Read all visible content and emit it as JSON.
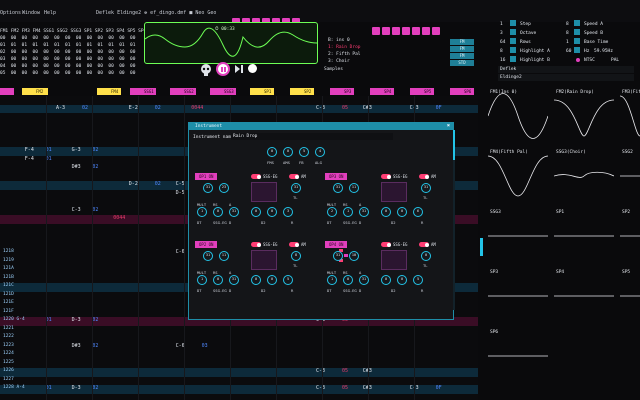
{
  "menu": {
    "items": [
      "Options",
      "Window",
      "Help"
    ],
    "title": "Deflek Eldinge2 ❁ ef_dingo.dmf ■ Neo Geo"
  },
  "channel_table": {
    "header": "FM1 FM2 FM3 FM4 SSG1 SSG2 SSG3 SP1 SP2 SP3 SP4 SP5 SP6",
    "rows": [
      "00  00  00  00  00  00  00  00  00  00  00  00  00",
      "01  01  01  01  01  01  01  01  01  01  01  01  01",
      "02  00  00  00  00  00  00  00  00  00  00  00  00",
      "03  00  00  00  00  00  00  00  00  00  00  00  00",
      "04  00  00  00  00  00  00  00  00  00  00  00  00",
      "05  00  00  00  00  00  00  00  00  00  00  00  00"
    ]
  },
  "scope": {
    "time": "⏱ 00:33"
  },
  "instruments": {
    "label": "B: ins 0",
    "items": [
      "1: Rain Drop",
      "2: Fifth Pal",
      "3: Choir"
    ],
    "selected_index": 0,
    "samples_label": "Samples",
    "fm_buttons": [
      "FM",
      "FM",
      "FM",
      "STD"
    ]
  },
  "settings": {
    "rows": [
      {
        "num1": "1",
        "label1": "Step",
        "num2": "8",
        "label2": "Speed A"
      },
      {
        "num1": "3",
        "label1": "Octave",
        "num2": "8",
        "label2": "Speed B"
      },
      {
        "num1": "64",
        "label1": "Rows",
        "num2": "1",
        "label2": "Base Time"
      },
      {
        "num1": "8",
        "label1": "Highlight A",
        "num2": "60",
        "label2": "Hz"
      },
      {
        "num1": "16",
        "label1": "Highlight B",
        "num2": "",
        "label2": "NTSC"
      }
    ],
    "hz_value": "59.95Hz",
    "region": "PAL",
    "song_author": "Deflek",
    "song_name": "Eldinge2"
  },
  "channel_headers": [
    {
      "label": "FM1",
      "color": "#e23fbd"
    },
    {
      "label": "FM2",
      "color": "#ffe04a"
    },
    {
      "label": "FM3",
      "color": "#e23fbd"
    },
    {
      "label": "FM4",
      "color": "#ffe04a"
    },
    {
      "label": "SSG1",
      "color": "#e23fbd"
    },
    {
      "label": "SSG2",
      "color": "#e23fbd"
    },
    {
      "label": "SSG3",
      "color": "#e23fbd"
    },
    {
      "label": "SP1",
      "color": "#ffe04a"
    },
    {
      "label": "SP2",
      "color": "#ffe04a"
    },
    {
      "label": "SP3",
      "color": "#e23fbd"
    },
    {
      "label": "SP4",
      "color": "#e23fbd"
    },
    {
      "label": "SP5",
      "color": "#e23fbd"
    },
    {
      "label": "SP6",
      "color": "#e23fbd"
    }
  ],
  "pattern_rows": [
    {
      "num": "",
      "hl": "none",
      "cells": []
    },
    {
      "num": "",
      "hl": "hl",
      "cells": [
        {
          "c": 1,
          "t": "A-3",
          "k": "note"
        },
        {
          "c": 1.5,
          "t": "02",
          "k": "inst"
        },
        {
          "c": 2.4,
          "t": "E-2",
          "k": "note"
        },
        {
          "c": 2.9,
          "t": "02",
          "k": "inst"
        },
        {
          "c": 3.6,
          "t": "0044",
          "k": "fx"
        },
        {
          "c": 6,
          "t": "C-3",
          "k": "note"
        },
        {
          "c": 6.5,
          "t": "05",
          "k": "fx"
        },
        {
          "c": 6.9,
          "t": "C#3",
          "k": "note"
        },
        {
          "c": 7.8,
          "t": "C-3",
          "k": "note"
        },
        {
          "c": 8.3,
          "t": "0F",
          "k": "inst"
        }
      ]
    },
    {
      "num": "",
      "hl": "none",
      "cells": []
    },
    {
      "num": "",
      "hl": "none",
      "cells": []
    },
    {
      "num": "",
      "hl": "none",
      "cells": []
    },
    {
      "num": "",
      "hl": "none",
      "cells": []
    },
    {
      "num": "",
      "hl": "hl",
      "cells": [
        {
          "c": 0.4,
          "t": "F-4",
          "k": "note"
        },
        {
          "c": 0.8,
          "t": "01",
          "k": "inst"
        },
        {
          "c": 1.3,
          "t": "G-3",
          "k": "note"
        },
        {
          "c": 1.7,
          "t": "02",
          "k": "inst"
        }
      ]
    },
    {
      "num": "",
      "hl": "none",
      "cells": [
        {
          "c": 0.4,
          "t": "F-4",
          "k": "note"
        },
        {
          "c": 0.8,
          "t": "01",
          "k": "inst"
        }
      ]
    },
    {
      "num": "",
      "hl": "none",
      "cells": [
        {
          "c": 1.3,
          "t": "D#3",
          "k": "note"
        },
        {
          "c": 1.7,
          "t": "02",
          "k": "inst"
        }
      ]
    },
    {
      "num": "",
      "hl": "none",
      "cells": []
    },
    {
      "num": "",
      "hl": "hl",
      "cells": [
        {
          "c": 2.4,
          "t": "D-2",
          "k": "note"
        },
        {
          "c": 2.9,
          "t": "02",
          "k": "inst"
        },
        {
          "c": 3.3,
          "t": "C-5",
          "k": "note"
        },
        {
          "c": 3.7,
          "t": "03",
          "k": "inst"
        }
      ]
    },
    {
      "num": "",
      "hl": "none",
      "cells": [
        {
          "c": 3.3,
          "t": "D-5",
          "k": "note"
        },
        {
          "c": 3.7,
          "t": "03",
          "k": "inst"
        }
      ]
    },
    {
      "num": "",
      "hl": "none",
      "cells": []
    },
    {
      "num": "",
      "hl": "none",
      "cells": [
        {
          "c": 1.3,
          "t": "C-3",
          "k": "note"
        },
        {
          "c": 1.7,
          "t": "02",
          "k": "inst"
        }
      ]
    },
    {
      "num": "",
      "hl": "mag",
      "cells": [
        {
          "c": 2.1,
          "t": "0044",
          "k": "fx"
        }
      ]
    },
    {
      "num": "",
      "hl": "none",
      "cells": []
    },
    {
      "num": "",
      "hl": "none",
      "cells": []
    },
    {
      "num": "",
      "hl": "none",
      "cells": []
    },
    {
      "num": "1218",
      "hl": "none",
      "cells": [
        {
          "c": 3.3,
          "t": "C-6",
          "k": "note"
        },
        {
          "c": 3.8,
          "t": "03",
          "k": "inst"
        }
      ]
    },
    {
      "num": "1219",
      "hl": "none",
      "cells": []
    },
    {
      "num": "121A",
      "hl": "none",
      "cells": []
    },
    {
      "num": "121B",
      "hl": "none",
      "cells": []
    },
    {
      "num": "121C",
      "hl": "hl",
      "cells": []
    },
    {
      "num": "121D",
      "hl": "none",
      "cells": []
    },
    {
      "num": "121E",
      "hl": "none",
      "cells": [
        {
          "c": 6,
          "t": "C-3",
          "k": "note"
        },
        {
          "c": 6.5,
          "t": "00",
          "k": "fx"
        }
      ]
    },
    {
      "num": "121F",
      "hl": "none",
      "cells": []
    },
    {
      "num": "1220 G-4",
      "hl": "mag",
      "cells": [
        {
          "c": 0.8,
          "t": "01",
          "k": "inst"
        },
        {
          "c": 1.3,
          "t": "D-3",
          "k": "note"
        },
        {
          "c": 1.7,
          "t": "02",
          "k": "inst"
        },
        {
          "c": 6,
          "t": "C-3",
          "k": "note"
        },
        {
          "c": 6.5,
          "t": "05",
          "k": "fx"
        }
      ]
    },
    {
      "num": "1221",
      "hl": "none",
      "cells": []
    },
    {
      "num": "1222",
      "hl": "none",
      "cells": []
    },
    {
      "num": "1223",
      "hl": "none",
      "cells": [
        {
          "c": 1.3,
          "t": "D#3",
          "k": "note"
        },
        {
          "c": 1.7,
          "t": "02",
          "k": "inst"
        },
        {
          "c": 3.3,
          "t": "C-6",
          "k": "note"
        },
        {
          "c": 3.8,
          "t": "03",
          "k": "inst"
        }
      ]
    },
    {
      "num": "1224",
      "hl": "none",
      "cells": []
    },
    {
      "num": "1225",
      "hl": "none",
      "cells": []
    },
    {
      "num": "1226",
      "hl": "hl",
      "cells": [
        {
          "c": 6,
          "t": "C-3",
          "k": "note"
        },
        {
          "c": 6.5,
          "t": "05",
          "k": "fx"
        },
        {
          "c": 6.9,
          "t": "C#3",
          "k": "note"
        }
      ]
    },
    {
      "num": "1227",
      "hl": "none",
      "cells": []
    },
    {
      "num": "1228 A-4",
      "hl": "hl",
      "cells": [
        {
          "c": 0.8,
          "t": "01",
          "k": "inst"
        },
        {
          "c": 1.3,
          "t": "D-3",
          "k": "note"
        },
        {
          "c": 1.7,
          "t": "02",
          "k": "inst"
        },
        {
          "c": 6,
          "t": "C-3",
          "k": "note"
        },
        {
          "c": 6.5,
          "t": "05",
          "k": "fx"
        },
        {
          "c": 6.9,
          "t": "C#3",
          "k": "note"
        },
        {
          "c": 7.8,
          "t": "C-3",
          "k": "note"
        },
        {
          "c": 8.3,
          "t": "0F",
          "k": "inst"
        }
      ]
    }
  ],
  "osc_channels": [
    {
      "label": "FM1(Ins 0)",
      "wave": "sine"
    },
    {
      "label": "FM2(Rain Drop)",
      "wave": "dip"
    },
    {
      "label": "FM3(Fift",
      "wave": "half"
    },
    {
      "label": "FM4(Fifth Pal)",
      "wave": "pulse"
    },
    {
      "label": "SSG3(Choir)",
      "wave": "small"
    },
    {
      "label": "SSG2",
      "wave": "flat"
    },
    {
      "label": "SSG3",
      "wave": "flat"
    },
    {
      "label": "SP1",
      "wave": "flat"
    },
    {
      "label": "SP2",
      "wave": "flat"
    },
    {
      "label": "SP3",
      "wave": "flat"
    },
    {
      "label": "SP4",
      "wave": "flat"
    },
    {
      "label": "SP5",
      "wave": "flat"
    },
    {
      "label": "SP6",
      "wave": "flat"
    }
  ],
  "inst_window": {
    "title": "Instrument",
    "name_label": "Instrument name",
    "name_value": "Rain Drop",
    "global_knobs": [
      {
        "label": "FMS",
        "value": "0"
      },
      {
        "label": "AMS",
        "value": "0"
      },
      {
        "label": "FB",
        "value": "5"
      },
      {
        "label": "ALG",
        "value": "4"
      }
    ],
    "operators": [
      {
        "op_label": "OP1 ON",
        "ssg": "SSG-EG",
        "am": "AM",
        "top_knobs": [
          {
            "l": "",
            "v": "31"
          },
          {
            "l": "",
            "v": "23"
          },
          {
            "l": "TL",
            "v": "31"
          }
        ],
        "mid_labels": [
          "MULT",
          "RS",
          "A"
        ],
        "mid_vals": [
          "1",
          "0",
          "31"
        ],
        "bot_labels": [
          "DT",
          "SSG-EG",
          "D"
        ],
        "bot_vals": [
          "0",
          "0",
          "3"
        ],
        "extra_labels": [
          "D2",
          "R"
        ]
      },
      {
        "op_label": "OP3 ON",
        "ssg": "SSG-EG",
        "am": "AM",
        "top_knobs": [
          {
            "l": "",
            "v": "31"
          },
          {
            "l": "",
            "v": "11"
          },
          {
            "l": "TL",
            "v": "31"
          }
        ],
        "mid_labels": [
          "MULT",
          "RS",
          "A"
        ],
        "mid_vals": [
          "2",
          "1",
          "31"
        ],
        "bot_labels": [
          "DT",
          "SSG-EG",
          "D"
        ],
        "bot_vals": [
          "0",
          "0",
          "6"
        ],
        "extra_labels": [
          "D2",
          "R"
        ]
      },
      {
        "op_label": "OP2 ON",
        "ssg": "SSG-EG",
        "am": "AM",
        "top_knobs": [
          {
            "l": "",
            "v": "31"
          },
          {
            "l": "",
            "v": "11"
          },
          {
            "l": "TL",
            "v": "8"
          }
        ],
        "mid_labels": [
          "MULT",
          "RS",
          "A"
        ],
        "mid_vals": [
          "1",
          "0",
          "31"
        ],
        "bot_labels": [
          "DT",
          "SSG-EG",
          "D"
        ],
        "bot_vals": [
          "0",
          "0",
          "5"
        ],
        "extra_labels": [
          "D2",
          "R"
        ]
      },
      {
        "op_label": "OP4 ON",
        "ssg": "SSG-EG",
        "am": "AM",
        "top_knobs": [
          {
            "l": "",
            "v": "31"
          },
          {
            "l": "",
            "v": "10"
          },
          {
            "l": "TL",
            "v": "0"
          }
        ],
        "mid_labels": [
          "MULT",
          "RS",
          "A"
        ],
        "mid_vals": [
          "1",
          "0",
          "31"
        ],
        "bot_labels": [
          "DT",
          "SSG-EG",
          "D"
        ],
        "bot_vals": [
          "0",
          "0",
          "5"
        ],
        "extra_labels": [
          "D2",
          "R"
        ]
      }
    ]
  },
  "colors": {
    "accent_cyan": "#23c4e8",
    "accent_magenta": "#e23fbd",
    "accent_yellow": "#ffe04a",
    "scope_green": "#6dff55",
    "record_red": "#ff3d74"
  }
}
